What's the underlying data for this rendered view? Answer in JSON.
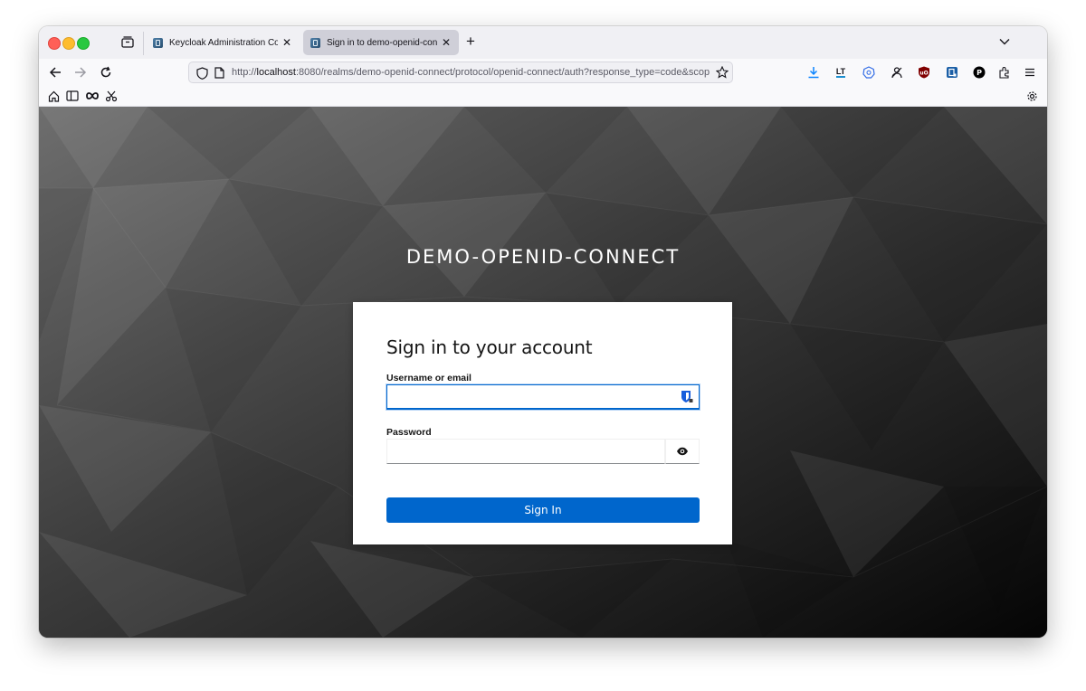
{
  "browser": {
    "tabs": [
      {
        "label": "Keycloak Administration Console",
        "active": false
      },
      {
        "label": "Sign in to demo-openid-connect",
        "active": true
      }
    ],
    "url": {
      "prefix": "http://",
      "host": "localhost",
      "rest": ":8080/realms/demo-openid-connect/protocol/openid-connect/auth?response_type=code&scope=openid"
    },
    "extensions": [
      "download-icon",
      "languagetool-icon",
      "kubernetes-icon",
      "account-icon",
      "ublock-icon",
      "keycloak-icon",
      "p-extension-icon",
      "extensions-icon",
      "menu-icon"
    ],
    "extension_glyphs": {
      "languagetool": "LT",
      "ublock": "uO",
      "p": "P"
    }
  },
  "page": {
    "realm_name": "DEMO-OPENID-CONNECT",
    "card": {
      "title": "Sign in to your account",
      "username_label": "Username or email",
      "username_value": "",
      "password_label": "Password",
      "password_value": "",
      "submit_label": "Sign In"
    },
    "colors": {
      "primary": "#0066cc",
      "background": "#2b2b2b"
    }
  }
}
